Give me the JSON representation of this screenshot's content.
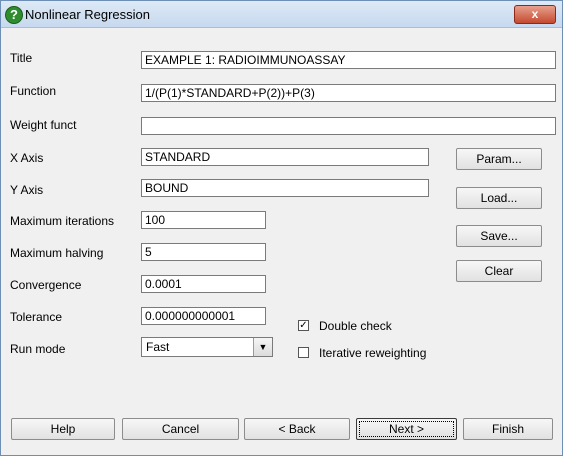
{
  "window": {
    "title": "Nonlinear Regression",
    "close_label": "x"
  },
  "fields": {
    "title": {
      "label": "Title",
      "value": "EXAMPLE 1: RADIOIMMUNOASSAY"
    },
    "function": {
      "label": "Function",
      "value": "1/(P(1)*STANDARD+P(2))+P(3)"
    },
    "weight_function": {
      "label": "Weight funct",
      "value": ""
    },
    "x_axis": {
      "label": "X Axis",
      "value": "STANDARD"
    },
    "y_axis": {
      "label": "Y Axis",
      "value": "BOUND"
    },
    "max_iterations": {
      "label": "Maximum iterations",
      "value": "100"
    },
    "max_halving": {
      "label": "Maximum halving",
      "value": "5"
    },
    "convergence": {
      "label": "Convergence",
      "value": "0.0001"
    },
    "tolerance": {
      "label": "Tolerance",
      "value": "0.000000000001"
    },
    "run_mode": {
      "label": "Run mode",
      "value": "Fast"
    }
  },
  "side_buttons": {
    "param": "Param...",
    "load": "Load...",
    "save": "Save...",
    "clear": "Clear"
  },
  "options": {
    "double_check": {
      "label": "Double check",
      "checked": true
    },
    "iterative_reweighting": {
      "label": "Iterative reweighting",
      "checked": false
    }
  },
  "footer_buttons": {
    "help": "Help",
    "cancel": "Cancel",
    "back": "< Back",
    "next": "Next >",
    "finish": "Finish"
  },
  "icons": {
    "title_icon": "help-question-icon",
    "close_icon": "close-icon",
    "dropdown_icon": "chevron-down-icon",
    "check_mark": "✓"
  }
}
